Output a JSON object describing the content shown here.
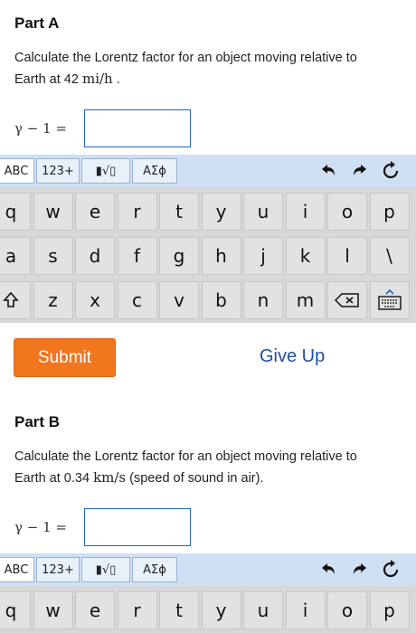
{
  "part_a": {
    "title": "Part A",
    "prompt_line1": "Calculate the Lorentz factor for an object moving relative to",
    "prompt_line2_pre": "Earth at 42 ",
    "prompt_unit": "mi/h",
    "prompt_line2_post": " .",
    "answer_label": "γ − 1 =",
    "answer_value": ""
  },
  "part_b": {
    "title": "Part B",
    "prompt_line1": "Calculate the Lorentz factor for an object moving relative to",
    "prompt_line2_pre": "Earth at 0.34 ",
    "prompt_unit": "km/s",
    "prompt_line2_post": " (speed of sound in air).",
    "answer_label": "γ − 1 =",
    "answer_value": ""
  },
  "keyboard_toolbar": {
    "abc": "ABC",
    "num": "123+",
    "templates": "▮√▯",
    "greek": "ΑΣϕ",
    "undo_icon": "undo-icon",
    "redo_icon": "redo-icon",
    "reset_icon": "reset-icon"
  },
  "keyboard": {
    "row1": [
      "q",
      "w",
      "e",
      "r",
      "t",
      "y",
      "u",
      "i",
      "o",
      "p"
    ],
    "row2": [
      "a",
      "s",
      "d",
      "f",
      "g",
      "h",
      "j",
      "k",
      "l",
      "\\"
    ],
    "row3_shift_icon": "shift-icon",
    "row3": [
      "z",
      "x",
      "c",
      "v",
      "b",
      "n",
      "m"
    ],
    "row3_backspace_icon": "backspace-icon",
    "row3_hide_icon": "keyboard-hide-icon"
  },
  "actions": {
    "submit_label": "Submit",
    "giveup_label": "Give Up"
  },
  "colors": {
    "submit_bg": "#f2761d",
    "giveup_text": "#1f4f9e",
    "toolbar_bg": "#cfe0f4",
    "input_border": "#1f66c4"
  }
}
